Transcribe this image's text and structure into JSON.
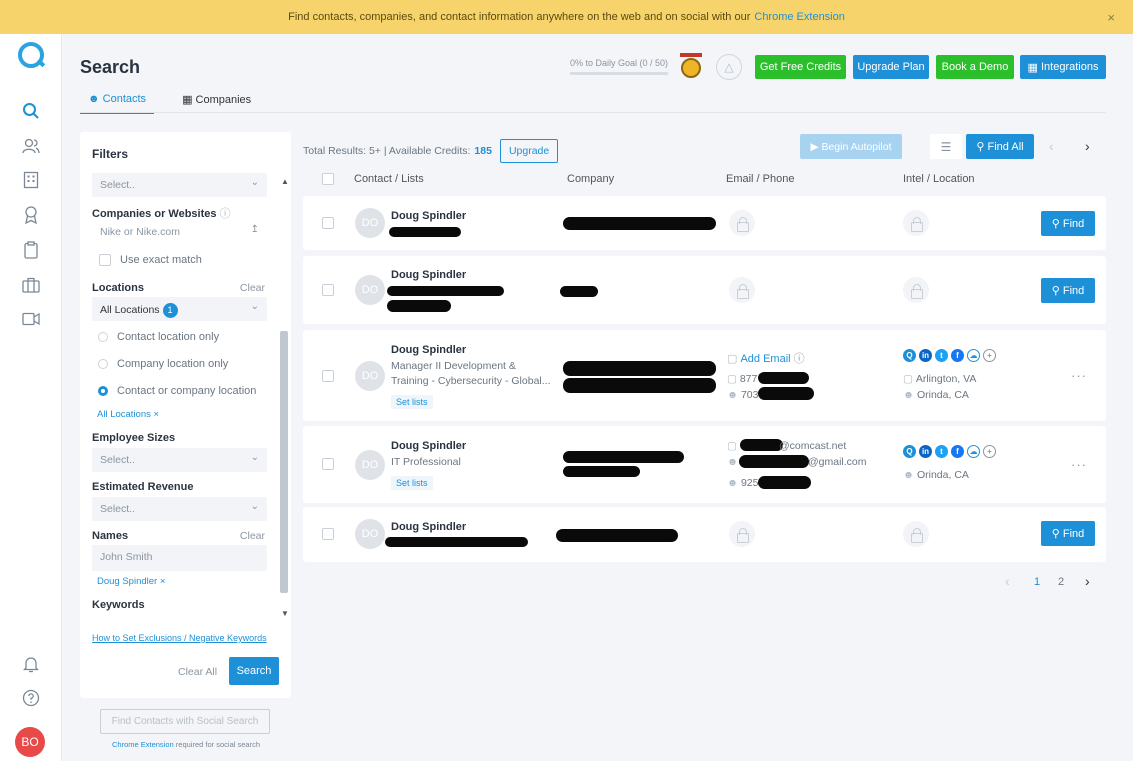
{
  "banner": {
    "text": "Find contacts, companies, and contact information anywhere on the web and on social with our",
    "link": "Chrome Extension",
    "close": "×"
  },
  "rail": {
    "avatar": "BO"
  },
  "header": {
    "title": "Search",
    "tabs": [
      {
        "label": "Contacts"
      },
      {
        "label": "Companies"
      }
    ],
    "goal": "0% to Daily Goal (0 / 50)",
    "buttons": {
      "free_credits": "Get Free Credits",
      "upgrade": "Upgrade Plan",
      "demo": "Book a Demo",
      "integrations": "Integrations"
    }
  },
  "filters": {
    "title": "Filters",
    "select_placeholder": "Select..",
    "companies_label": "Companies or Websites",
    "companies_placeholder": "Nike or Nike.com",
    "exact_match": "Use exact match",
    "locations_label": "Locations",
    "clear": "Clear",
    "all_locations": "All Locations",
    "locations_count": "1",
    "loc_options": [
      "Contact location only",
      "Company location only",
      "Contact or company location"
    ],
    "loc_chip": "All Locations ×",
    "employee_label": "Employee Sizes",
    "revenue_label": "Estimated Revenue",
    "names_label": "Names",
    "names_placeholder": "John Smith",
    "names_chip": "Doug Spindler ×",
    "keywords_label": "Keywords",
    "exclusions_link": "How to Set Exclusions / Negative Keywords",
    "clear_all": "Clear All",
    "search": "Search"
  },
  "social_search": {
    "button": "Find Contacts with Social Search",
    "note_link": "Chrome Extension",
    "note": "required for social search"
  },
  "results": {
    "total": "Total Results: 5+  |  Available Credits:",
    "credits": "185",
    "upgrade": "Upgrade",
    "autopilot": "Begin Autopilot",
    "find_all": "Find All",
    "columns": [
      "Contact / Lists",
      "Company",
      "Email / Phone",
      "Intel / Location"
    ],
    "rows": [
      {
        "name": "Doug Spindler",
        "initials": "DO",
        "find": "Find"
      },
      {
        "name": "Doug Spindler",
        "initials": "DO",
        "find": "Find"
      },
      {
        "name": "Doug Spindler",
        "initials": "DO",
        "title": "Manager II Development & Training - Cybersecurity - Global...",
        "set_lists": "Set lists",
        "add_email": "Add Email",
        "phone1": "877",
        "phone2": "703",
        "loc1": "Arlington, VA",
        "loc2": "Orinda, CA",
        "more": "···"
      },
      {
        "name": "Doug Spindler",
        "initials": "DO",
        "title": "IT Professional",
        "set_lists": "Set lists",
        "email1": "@comcast.net",
        "email2": "@gmail.com",
        "phone1": "925",
        "loc1": "Orinda, CA",
        "more": "···"
      },
      {
        "name": "Doug Spindler",
        "initials": "DO",
        "find": "Find"
      }
    ],
    "pages": [
      "1",
      "2"
    ]
  }
}
